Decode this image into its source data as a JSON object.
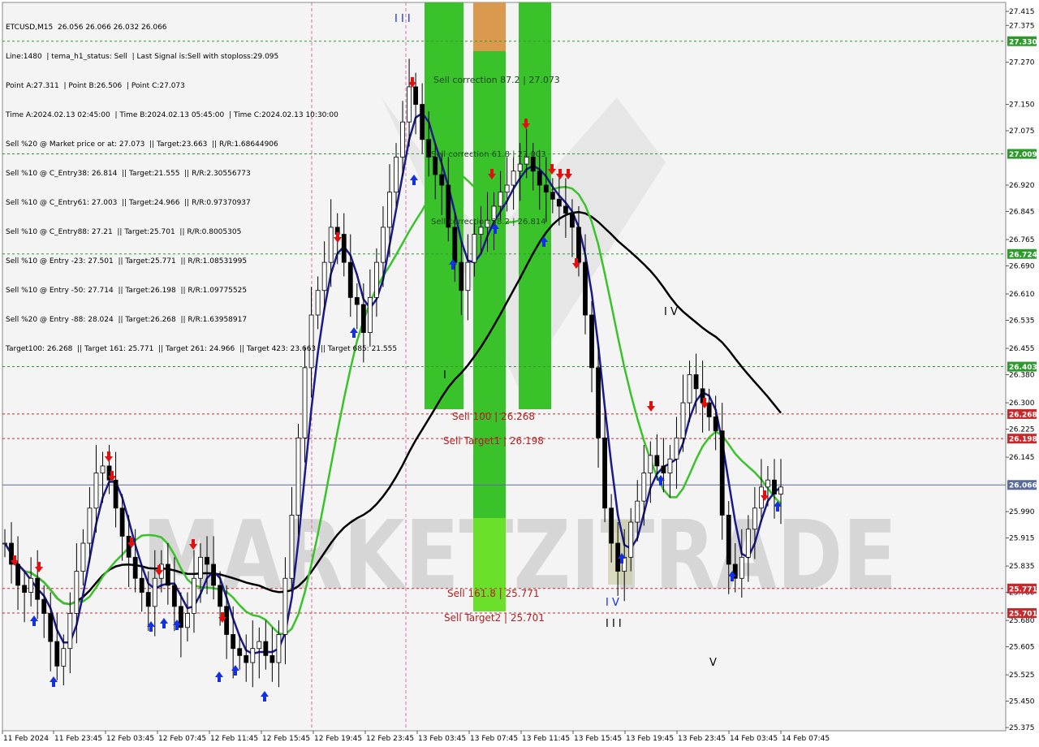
{
  "header": {
    "lines": [
      "ETCUSD,M15  26.056 26.066 26.032 26.066",
      "Line:1480  | tema_h1_status: Sell  | Last Signal is:Sell with stoploss:29.095",
      "Point A:27.311  | Point B:26.506  | Point C:27.073",
      "Time A:2024.02.13 02:45:00  | Time B:2024.02.13 05:45:00  | Time C:2024.02.13 10:30:00",
      "Sell %20 @ Market price or at: 27.073  || Target:23.663  || R/R:1.68644906",
      "Sell %10 @ C_Entry38: 26.814  || Target:21.555  || R/R:2.30556773",
      "Sell %10 @ C_Entry61: 27.003  || Target:24.966  || R/R:0.97370937",
      "Sell %10 @ C_Entry88: 27.21  || Target:25.701  || R/R:0.8005305",
      "Sell %10 @ Entry -23: 27.501  || Target:25.771  || R/R:1.08531995",
      "Sell %10 @ Entry -50: 27.714  || Target:26.198  || R/R:1.09775525",
      "Sell %20 @ Entry -88: 28.024  || Target:26.268  || R/R:1.63958917",
      "Target100: 26.268  || Target 161: 25.771  || Target 261: 24.966  || Target 423: 23.663  || Target 685: 21.555"
    ]
  },
  "chart_data": {
    "type": "candlestick",
    "symbol": "ETCUSD",
    "timeframe": "M15",
    "ylim": [
      25.375,
      27.415
    ],
    "y_ticks": [
      "27.415",
      "27.375",
      "27.330",
      "27.270",
      "27.150",
      "27.075",
      "27.009",
      "26.920",
      "26.845",
      "26.765",
      "26.724",
      "26.690",
      "26.610",
      "26.535",
      "26.455",
      "26.403",
      "26.380",
      "26.300",
      "26.268",
      "26.225",
      "26.198",
      "26.145",
      "26.066",
      "25.990",
      "25.915",
      "25.835",
      "25.771",
      "25.760",
      "25.701",
      "25.680",
      "25.605",
      "25.525",
      "25.450",
      "25.375"
    ],
    "x_ticks": [
      "11 Feb 2024",
      "11 Feb 23:45",
      "12 Feb 03:45",
      "12 Feb 07:45",
      "12 Feb 11:45",
      "12 Feb 15:45",
      "12 Feb 19:45",
      "12 Feb 23:45",
      "13 Feb 03:45",
      "13 Feb 07:45",
      "13 Feb 11:45",
      "13 Feb 15:45",
      "13 Feb 19:45",
      "13 Feb 23:45",
      "14 Feb 03:45",
      "14 Feb 07:45"
    ],
    "levels": [
      {
        "value": 27.33,
        "label": "27.330",
        "color": "#2e9a2e",
        "style": "dashed"
      },
      {
        "value": 27.009,
        "label": "27.009",
        "color": "#2e9a2e",
        "style": "dashed"
      },
      {
        "value": 26.724,
        "label": "26.724",
        "color": "#2e9a2e",
        "style": "dashed"
      },
      {
        "value": 26.403,
        "label": "26.403",
        "color": "#2e9a2e",
        "style": "dashed"
      },
      {
        "value": 26.268,
        "label": "26.268",
        "color": "#c8282a",
        "style": "dashed"
      },
      {
        "value": 26.198,
        "label": "26.198",
        "color": "#c8282a",
        "style": "dashed"
      },
      {
        "value": 26.066,
        "label": "26.066",
        "color": "#5a6a9a",
        "style": "solid"
      },
      {
        "value": 25.771,
        "label": "25.771",
        "color": "#c8282a",
        "style": "dashed"
      },
      {
        "value": 25.701,
        "label": "25.701",
        "color": "#c8282a",
        "style": "dashed"
      }
    ],
    "zone_labels": [
      {
        "text": "Sell correction 87.2 | 27.073",
        "color": "#1a4a1a"
      },
      {
        "text": "Sell correction 61.8 | 27.003",
        "color": "#1a4a1a"
      },
      {
        "text": "Sell correction 38.2 | 26.814",
        "color": "#1a4a1a"
      },
      {
        "text": "Sell 100 | 26.268",
        "color": "#b02020"
      },
      {
        "text": "Sell Target1 | 26.198",
        "color": "#b02020"
      },
      {
        "text": "Sell 161.8 | 25.771",
        "color": "#b02020"
      },
      {
        "text": "Sell Target2 | 25.701",
        "color": "#b02020"
      }
    ],
    "wave_labels": [
      "I I I",
      "I",
      "I V",
      "I V",
      "I I I",
      "V"
    ],
    "watermark": "MARKETZITRADE",
    "last_price": "26.066",
    "closes": [
      25.9,
      25.84,
      25.78,
      25.76,
      25.8,
      25.74,
      25.7,
      25.62,
      25.55,
      25.6,
      25.7,
      25.82,
      25.9,
      26.0,
      26.1,
      26.12,
      26.08,
      26.0,
      25.92,
      25.86,
      25.8,
      25.76,
      25.72,
      25.8,
      25.84,
      25.78,
      25.72,
      25.66,
      25.7,
      25.8,
      25.86,
      25.84,
      25.78,
      25.72,
      25.64,
      25.6,
      25.58,
      25.56,
      25.6,
      25.62,
      25.58,
      25.56,
      25.64,
      25.8,
      25.98,
      26.2,
      26.4,
      26.55,
      26.62,
      26.7,
      26.8,
      26.78,
      26.7,
      26.6,
      26.58,
      26.5,
      26.6,
      26.7,
      26.8,
      26.9,
      27.0,
      27.1,
      27.2,
      27.15,
      27.05,
      27.0,
      26.95,
      26.92,
      26.8,
      26.7,
      26.62,
      26.7,
      26.78,
      26.8,
      26.82,
      26.86,
      26.9,
      26.92,
      26.96,
      26.98,
      27.0,
      26.96,
      26.92,
      26.9,
      26.88,
      26.86,
      26.84,
      26.8,
      26.7,
      26.55,
      26.4,
      26.2,
      26.0,
      25.9,
      25.82,
      25.86,
      25.96,
      26.02,
      26.1,
      26.15,
      26.12,
      26.1,
      26.14,
      26.2,
      26.3,
      26.38,
      26.34,
      26.3,
      26.26,
      26.22,
      25.98,
      25.84,
      25.8,
      25.86,
      25.94,
      26.0,
      26.06,
      26.08,
      26.04,
      26.06
    ]
  }
}
